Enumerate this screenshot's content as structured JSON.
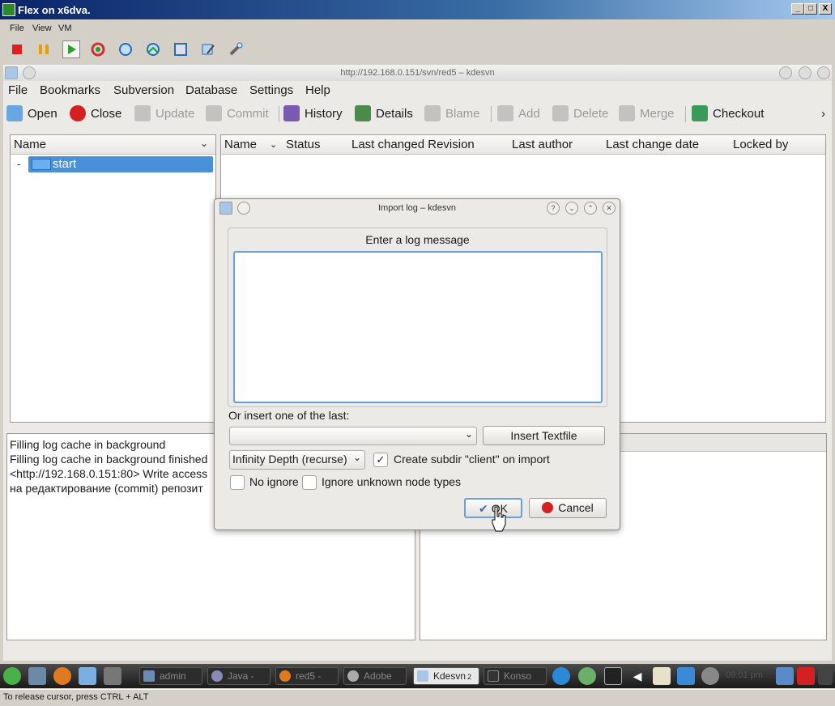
{
  "host": {
    "title": "Flex on x6dva.",
    "menu": [
      "File",
      "View",
      "VM"
    ],
    "window_buttons": [
      "_",
      "□",
      "X"
    ],
    "status": "To release cursor, press CTRL + ALT"
  },
  "guest": {
    "title": "http://192.168.0.151/svn/red5 – kdesvn",
    "menu": [
      "File",
      "Bookmarks",
      "Subversion",
      "Database",
      "Settings",
      "Help"
    ],
    "toolbar": {
      "open": "Open",
      "close": "Close",
      "update": "Update",
      "commit": "Commit",
      "history": "History",
      "details": "Details",
      "blame": "Blame",
      "add": "Add",
      "delete": "Delete",
      "merge": "Merge",
      "checkout": "Checkout",
      "more": "›"
    },
    "tree": {
      "header": "Name",
      "expander": "-",
      "item": "start"
    },
    "list": {
      "columns": [
        "Name",
        "Status",
        "Last changed Revision",
        "Last author",
        "Last change date",
        "Locked by"
      ]
    },
    "log": {
      "lines": [
        "Filling log cache in background",
        "Filling log cache in background finished",
        "<http://192.168.0.151:80> Write access",
        "на редактирование (commit) репозит"
      ]
    }
  },
  "dialog": {
    "title": "Import log – kdesvn",
    "title_buttons": [
      "?",
      "⌄",
      "⌃",
      "✕"
    ],
    "group_label": "Enter a log message",
    "message_value": "",
    "last_label": "Or insert one of the last:",
    "last_value": "",
    "insert_textfile": "Insert Textfile",
    "depth_value": "Infinity Depth (recurse)",
    "create_subdir": "Create subdir \"client\" on import",
    "create_subdir_checked": true,
    "no_ignore": "No ignore",
    "no_ignore_checked": false,
    "ignore_unknown": "Ignore unknown node types",
    "ignore_unknown_checked": false,
    "ok": "OK",
    "cancel": "Cancel"
  },
  "taskbar": {
    "tasks": [
      "admin",
      "Java -",
      "red5 -",
      "Adobe",
      "Kdesvn",
      "Konso"
    ],
    "active_task": "Kdesvn",
    "active_badge": "2",
    "clock": "09:01 pm"
  }
}
